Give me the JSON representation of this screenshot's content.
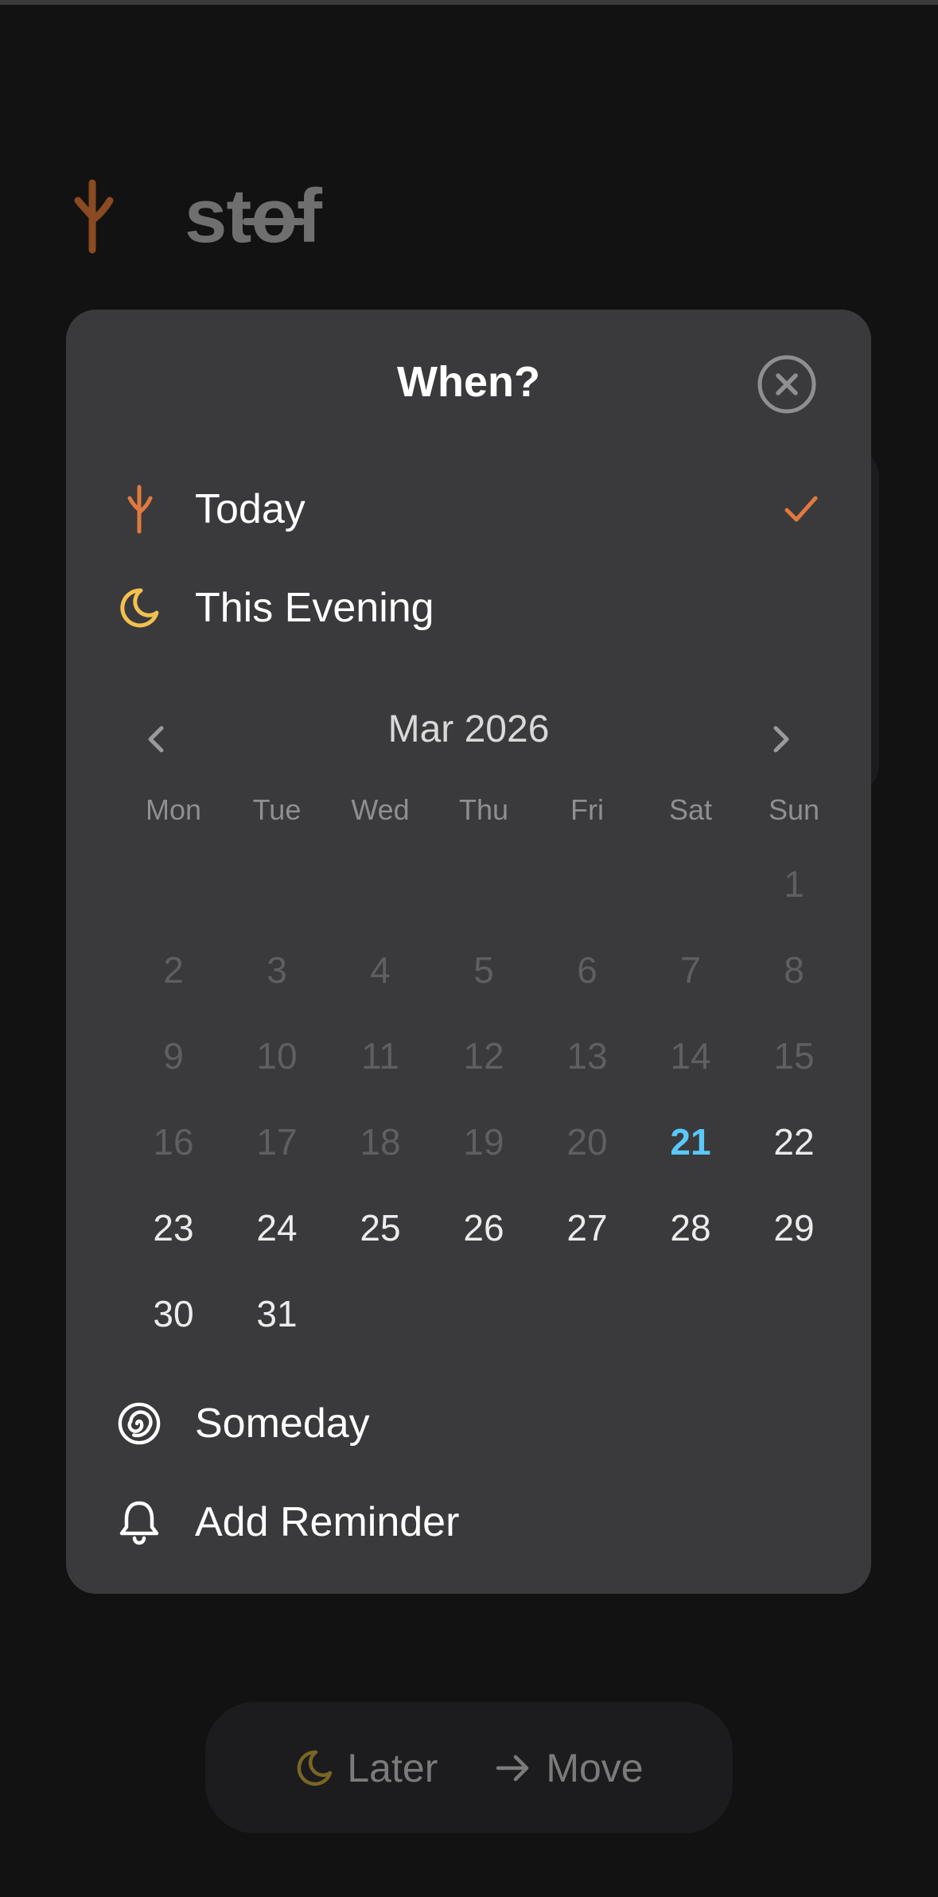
{
  "app": {
    "title": "stof",
    "logo_icon": "branch-icon",
    "accent": "#e07a3f"
  },
  "modal": {
    "title": "When?",
    "close_icon": "close-circle-icon",
    "options": [
      {
        "label": "Today",
        "icon": "branch-icon",
        "selected": true,
        "color": "#e07a3f"
      },
      {
        "label": "This Evening",
        "icon": "moon-icon",
        "selected": false,
        "color": "#f2c14e"
      }
    ],
    "calendar": {
      "month_label": "Mar 2026",
      "weekdays": [
        "Mon",
        "Tue",
        "Wed",
        "Thu",
        "Fri",
        "Sat",
        "Sun"
      ],
      "leading_blanks": 6,
      "days_in_month": 31,
      "today": 21,
      "today_color": "#5ac8fa"
    },
    "bottom_options": [
      {
        "label": "Someday",
        "icon": "spiral-icon"
      },
      {
        "label": "Add Reminder",
        "icon": "bell-icon"
      }
    ]
  },
  "bottom_bar": {
    "later_label": "Later",
    "later_icon": "moon-icon",
    "move_label": "Move",
    "move_icon": "arrow-right-icon"
  }
}
